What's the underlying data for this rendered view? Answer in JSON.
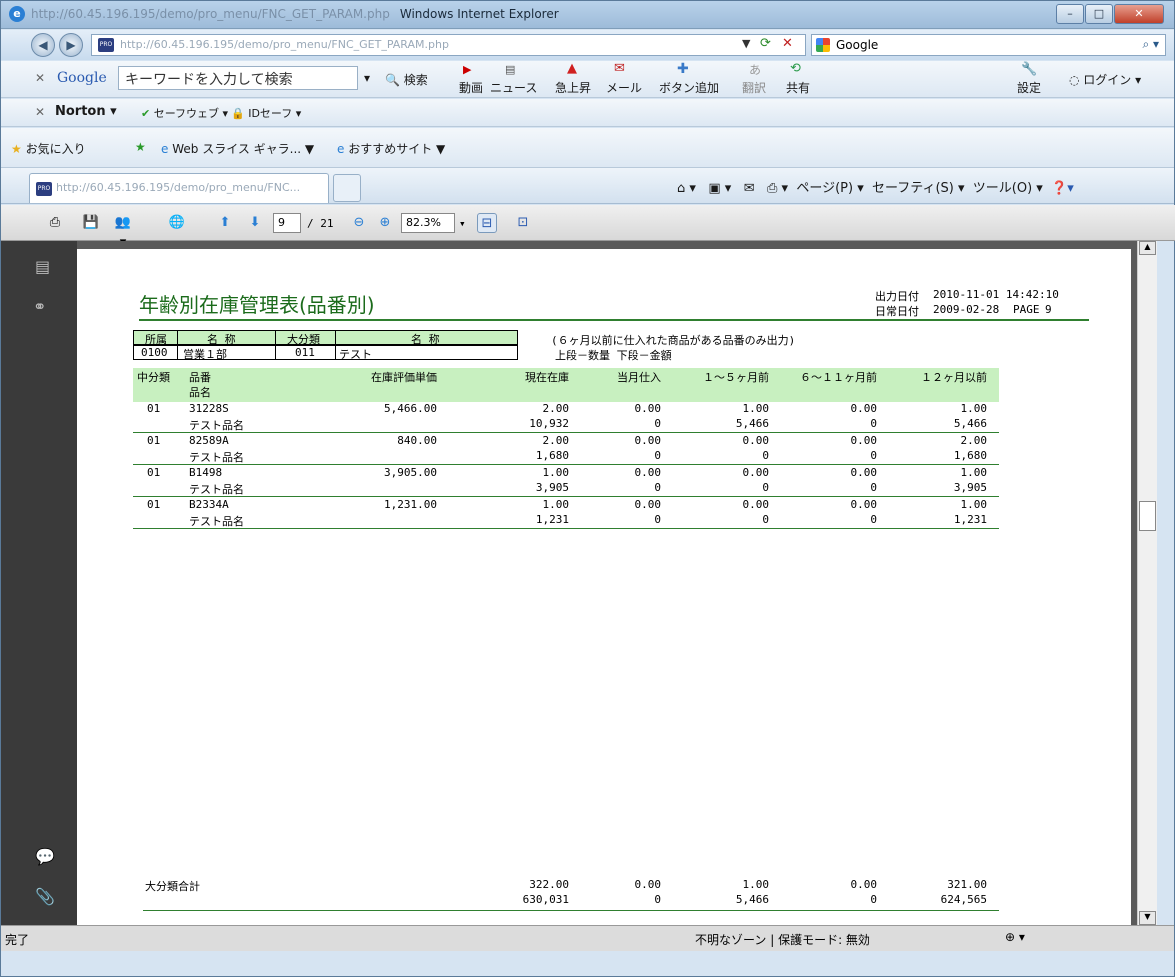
{
  "window": {
    "title_url": "http://60.45.196.195/demo/pro_menu/FNC_GET_PARAM.php",
    "title": "Windows Internet Explorer"
  },
  "address": {
    "url": "http://60.45.196.195/demo/pro_menu/FNC_GET_PARAM.php",
    "search_engine": "Google"
  },
  "google_toolbar": {
    "brand": "Google",
    "placeholder": "キーワードを入力して検索",
    "search_btn": "検索",
    "buttons": [
      "動画",
      "ニュース",
      "急上昇",
      "メール",
      "ボタン追加",
      "翻訳",
      "共有"
    ],
    "settings": "設定",
    "login": "ログイン"
  },
  "norton": {
    "brand": "Norton",
    "safeweb": "セーフウェブ",
    "idsafe": "IDセーフ"
  },
  "favorites": {
    "label": "お気に入り",
    "webslice": "Web スライス ギャラ...",
    "suggested": "おすすめサイト"
  },
  "tab": {
    "label": "http://60.45.196.195/demo/pro_menu/FNC..."
  },
  "command_bar": {
    "page": "ページ(P)",
    "safety": "セーフティ(S)",
    "tools": "ツール(O)"
  },
  "pdf": {
    "page_current": "9",
    "page_total": "/ 21",
    "zoom": "82.3%"
  },
  "report": {
    "title": "年齢別在庫管理表(品番別)",
    "out_date_label": "出力日付",
    "out_date": "2010-11-01 14:42:10",
    "daily_date_label": "日常日付",
    "daily_date": "2009-02-28",
    "page_label": "PAGE",
    "page": "9",
    "hdr": {
      "shozoku": "所属",
      "meisho1": "名 称",
      "daibunrui": "大分類",
      "meisho2": "名 称",
      "code1": "0100",
      "name1": "営業１部",
      "code2": "011",
      "name2": "テスト"
    },
    "note1": "(６ヶ月以前に仕入れた商品がある品番のみ出力)",
    "note2": "上段－数量 下段－金額",
    "cols": [
      "中分類",
      "品番",
      "品名",
      "在庫評価単価",
      "現在在庫",
      "当月仕入",
      "１～５ヶ月前",
      "６～１１ヶ月前",
      "１２ヶ月以前"
    ],
    "rows": [
      {
        "cat": "01",
        "code": "31228S",
        "name": "テスト品名",
        "price": "5,466.00",
        "q": [
          "2.00",
          "0.00",
          "1.00",
          "0.00",
          "1.00"
        ],
        "a": [
          "10,932",
          "0",
          "5,466",
          "0",
          "5,466"
        ]
      },
      {
        "cat": "01",
        "code": "82589A",
        "name": "テスト品名",
        "price": "840.00",
        "q": [
          "2.00",
          "0.00",
          "0.00",
          "0.00",
          "2.00"
        ],
        "a": [
          "1,680",
          "0",
          "0",
          "0",
          "1,680"
        ]
      },
      {
        "cat": "01",
        "code": "B1498",
        "name": "テスト品名",
        "price": "3,905.00",
        "q": [
          "1.00",
          "0.00",
          "0.00",
          "0.00",
          "1.00"
        ],
        "a": [
          "3,905",
          "0",
          "0",
          "0",
          "3,905"
        ]
      },
      {
        "cat": "01",
        "code": "B2334A",
        "name": "テスト品名",
        "price": "1,231.00",
        "q": [
          "1.00",
          "0.00",
          "0.00",
          "0.00",
          "1.00"
        ],
        "a": [
          "1,231",
          "0",
          "0",
          "0",
          "1,231"
        ]
      }
    ],
    "total": {
      "label": "大分類合計",
      "q": [
        "322.00",
        "0.00",
        "1.00",
        "0.00",
        "321.00"
      ],
      "a": [
        "630,031",
        "0",
        "5,466",
        "0",
        "624,565"
      ]
    }
  },
  "status": {
    "text": "完了",
    "zone": "不明なゾーン | 保護モード: 無効"
  }
}
